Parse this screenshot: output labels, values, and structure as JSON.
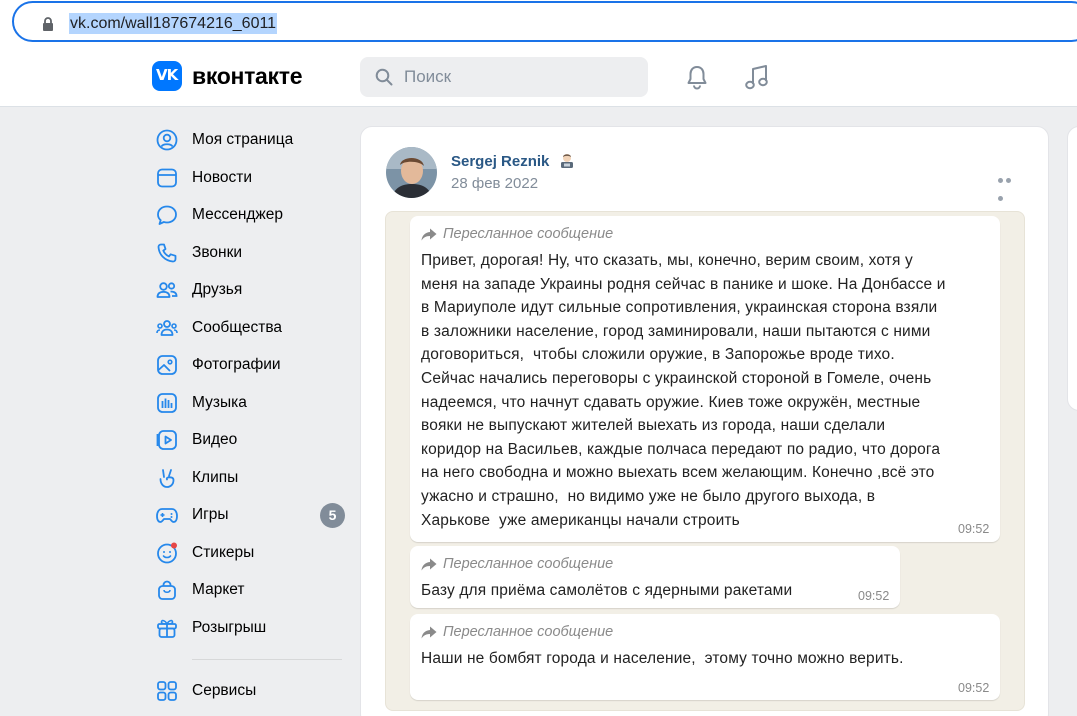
{
  "browser": {
    "url": "vk.com/wall187674216_6011"
  },
  "header": {
    "brand": "вконтакте",
    "logo_text": "VK",
    "search_placeholder": "Поиск",
    "accent_color": "#0077ff"
  },
  "sidebar": {
    "items": [
      {
        "label": "Моя страница",
        "icon": "profile-icon"
      },
      {
        "label": "Новости",
        "icon": "news-icon"
      },
      {
        "label": "Мессенджер",
        "icon": "messenger-icon"
      },
      {
        "label": "Звонки",
        "icon": "phone-icon"
      },
      {
        "label": "Друзья",
        "icon": "friends-icon"
      },
      {
        "label": "Сообщества",
        "icon": "communities-icon"
      },
      {
        "label": "Фотографии",
        "icon": "photos-icon"
      },
      {
        "label": "Музыка",
        "icon": "music-icon"
      },
      {
        "label": "Видео",
        "icon": "video-icon"
      },
      {
        "label": "Клипы",
        "icon": "clips-icon"
      },
      {
        "label": "Игры",
        "icon": "games-icon",
        "badge": "5"
      },
      {
        "label": "Стикеры",
        "icon": "stickers-icon"
      },
      {
        "label": "Маркет",
        "icon": "market-icon"
      },
      {
        "label": "Розыгрыш",
        "icon": "gift-icon"
      }
    ],
    "services": {
      "label": "Сервисы",
      "icon": "services-icon"
    }
  },
  "post": {
    "author": "Sergej Reznik",
    "date": "28 фев 2022",
    "messages": [
      {
        "forwarded_label": "Пересланное сообщение",
        "text": "Привет, дорогая! Ну, что сказать, мы, конечно, верим своим, хотя у\nменя на западе Украины родня сейчас в панике и шоке. На Донбассе и\nв Мариуполе идут сильные сопротивления, украинская сторона взяли\nв заложники население, город заминировали, наши пытаются с ними\nдоговориться,  чтобы сложили оружие, в Запорожье вроде тихо.\nСейчас начались переговоры с украинской стороной в Гомеле, очень\nнадеемся, что начнут сдавать оружие. Киев тоже окружён, местные\nвояки не выпускают жителей выехать из города, наши сделали\nкоридор на Васильев, каждые полчаса передают по радио, что дорога\nна него свободна и можно выехать всем желающим. Конечно ,всё это\nужасно и страшно,  но видимо уже не было другого выхода, в\nХарькове  уже американцы начали строить",
        "time": "09:52"
      },
      {
        "forwarded_label": "Пересланное сообщение",
        "text": "Базу для приёма самолётов с ядерными ракетами",
        "time": "09:52"
      },
      {
        "forwarded_label": "Пересланное сообщение",
        "text": "Наши не бомбят города и население,  этому точно можно верить.",
        "time": "09:52"
      }
    ]
  }
}
